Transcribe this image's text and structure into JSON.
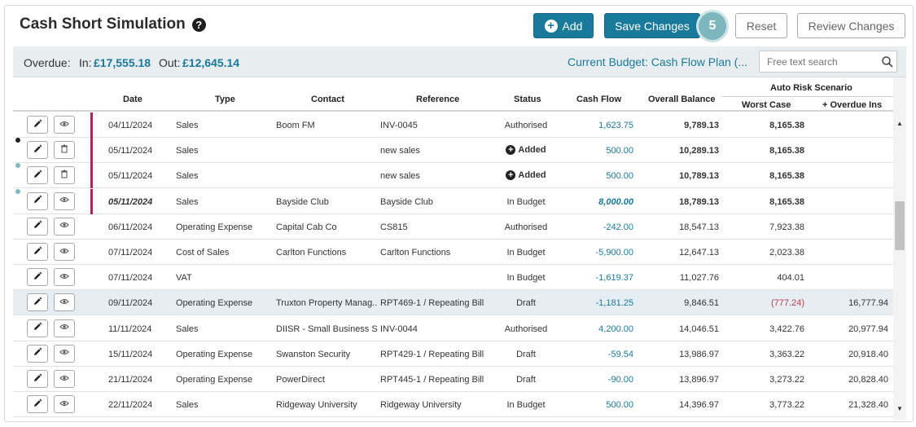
{
  "header": {
    "title": "Cash Short Simulation",
    "help_glyph": "?",
    "add_label": "Add",
    "save_label": "Save Changes",
    "pending_count": "5",
    "reset_label": "Reset",
    "review_label": "Review Changes"
  },
  "summary": {
    "overdue_label": "Overdue:",
    "in_label": "In:",
    "in_value": "£17,555.18",
    "out_label": "Out:",
    "out_value": "£12,645.14",
    "budget_link": "Current Budget: Cash Flow Plan (...",
    "search_placeholder": "Free text search"
  },
  "columns": {
    "date": "Date",
    "type": "Type",
    "contact": "Contact",
    "reference": "Reference",
    "status": "Status",
    "cash_flow": "Cash Flow",
    "overall_balance": "Overall Balance",
    "auto_risk": "Auto Risk Scenario",
    "worst_case": "Worst Case",
    "overdue_ins": "+ Overdue Ins"
  },
  "rows": [
    {
      "date": "04/11/2024",
      "type": "Sales",
      "contact": "Boom FM",
      "reference": "INV-0045",
      "status": "Authorised",
      "cash_flow": "1,623.75",
      "balance": "9,789.13",
      "worst": "8,165.38",
      "overdue": ""
    },
    {
      "date": "05/11/2024",
      "type": "Sales",
      "contact": "",
      "reference": "new sales",
      "status": "Added",
      "cash_flow": "500.00",
      "balance": "10,289.13",
      "worst": "8,165.38",
      "overdue": ""
    },
    {
      "date": "05/11/2024",
      "type": "Sales",
      "contact": "",
      "reference": "new sales",
      "status": "Added",
      "cash_flow": "500.00",
      "balance": "10,789.13",
      "worst": "8,165.38",
      "overdue": ""
    },
    {
      "date": "05/11/2024",
      "type": "Sales",
      "contact": "Bayside Club",
      "reference": "Bayside Club",
      "status": "In Budget",
      "cash_flow": "8,000.00",
      "balance": "18,789.13",
      "worst": "8,165.38",
      "overdue": ""
    },
    {
      "date": "06/11/2024",
      "type": "Operating Expense",
      "contact": "Capital Cab Co",
      "reference": "CS815",
      "status": "Authorised",
      "cash_flow": "-242.00",
      "balance": "18,547.13",
      "worst": "7,923.38",
      "overdue": ""
    },
    {
      "date": "07/11/2024",
      "type": "Cost of Sales",
      "contact": "Carlton Functions",
      "reference": "Carlton Functions",
      "status": "In Budget",
      "cash_flow": "-5,900.00",
      "balance": "12,647.13",
      "worst": "2,023.38",
      "overdue": ""
    },
    {
      "date": "07/11/2024",
      "type": "VAT",
      "contact": "",
      "reference": "",
      "status": "In Budget",
      "cash_flow": "-1,619.37",
      "balance": "11,027.76",
      "worst": "404.01",
      "overdue": ""
    },
    {
      "date": "09/11/2024",
      "type": "Operating Expense",
      "contact": "Truxton Property Manag...",
      "reference": "RPT469-1 / Repeating Bill",
      "status": "Draft",
      "cash_flow": "-1,181.25",
      "balance": "9,846.51",
      "worst": "(777.24)",
      "overdue": "16,777.94"
    },
    {
      "date": "11/11/2024",
      "type": "Sales",
      "contact": "DIISR - Small Business S...",
      "reference": "INV-0044",
      "status": "Authorised",
      "cash_flow": "4,200.00",
      "balance": "14,046.51",
      "worst": "3,422.76",
      "overdue": "20,977.94"
    },
    {
      "date": "15/11/2024",
      "type": "Operating Expense",
      "contact": "Swanston Security",
      "reference": "RPT429-1 / Repeating Bill",
      "status": "Draft",
      "cash_flow": "-59.54",
      "balance": "13,986.97",
      "worst": "3,363.22",
      "overdue": "20,918.40"
    },
    {
      "date": "21/11/2024",
      "type": "Operating Expense",
      "contact": "PowerDirect",
      "reference": "RPT445-1 / Repeating Bill",
      "status": "Draft",
      "cash_flow": "-90.00",
      "balance": "13,896.97",
      "worst": "3,273.22",
      "overdue": "20,828.40"
    },
    {
      "date": "22/11/2024",
      "type": "Sales",
      "contact": "Ridgeway University",
      "reference": "Ridgeway University",
      "status": "In Budget",
      "cash_flow": "500.00",
      "balance": "14,396.97",
      "worst": "3,773.22",
      "overdue": "21,328.40"
    }
  ],
  "scroll": {
    "up_glyph": "▲",
    "down_glyph": "▼"
  },
  "colors": {
    "accent": "#1a7a9b",
    "marker": "#b52156",
    "negative": "#c0394b",
    "pending_badge": "#7eb6bd"
  }
}
